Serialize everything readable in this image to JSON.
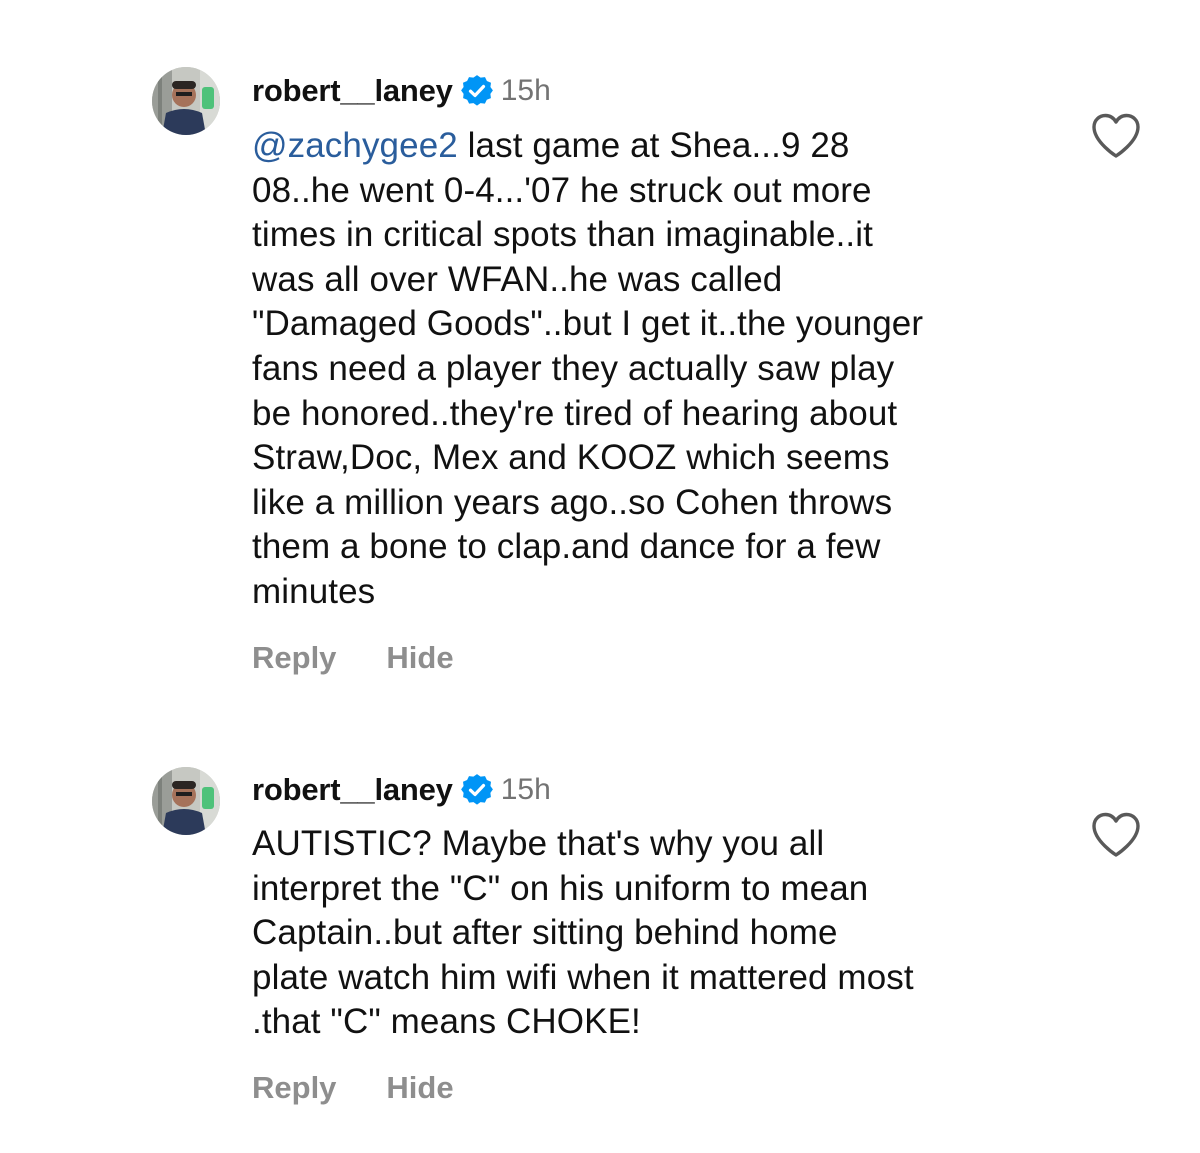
{
  "comments": [
    {
      "username": "robert__laney",
      "time": "15h",
      "mention": "@zachygee2",
      "text": " last game at Shea...9 28\n08..he went 0-4...'07 he struck out more\ntimes in critical spots than imaginable..it\nwas all over WFAN..he was called\n\"Damaged Goods\"..but I get it..the younger\nfans need a player they actually saw play\nbe honored..they're tired of hearing about\nStraw,Doc, Mex and KOOZ which seems\nlike a million years ago..so Cohen throws\nthem a bone to clap.and dance for a few\nminutes",
      "reply_label": "Reply",
      "hide_label": "Hide"
    },
    {
      "username": "robert__laney",
      "time": "15h",
      "text": "AUTISTIC? Maybe that's why you all\ninterpret the \"C\" on his uniform to mean\nCaptain..but after sitting behind home\nplate watch him wifi when it mattered most\n.that \"C\" means CHOKE!",
      "reply_label": "Reply",
      "hide_label": "Hide"
    }
  ],
  "icons": {
    "verified": "verified-badge-icon",
    "like": "heart-outline-icon"
  },
  "colors": {
    "mention": "#2a5d9c",
    "verified": "#0095f6",
    "secondary_text": "#737373"
  }
}
